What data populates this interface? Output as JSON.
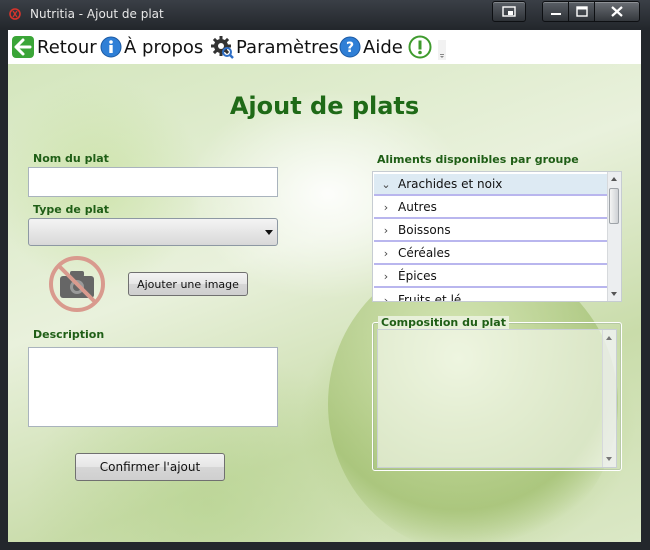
{
  "window": {
    "title": "Nutritia - Ajout de plat"
  },
  "toolbar": {
    "back_label": "Retour",
    "about_label": "À propos",
    "settings_label": "Paramètres",
    "help_label": "Aide"
  },
  "page": {
    "title": "Ajout de plats"
  },
  "form": {
    "name_label": "Nom du plat",
    "name_value": "",
    "type_label": "Type de plat",
    "type_value": "",
    "add_image_label": "Ajouter une image",
    "description_label": "Description",
    "description_value": "",
    "confirm_label": "Confirmer l'ajout"
  },
  "foods": {
    "label": "Aliments disponibles par groupe",
    "groups": [
      {
        "label": "Arachides et noix",
        "expanded": true
      },
      {
        "label": "Autres",
        "expanded": false
      },
      {
        "label": "Boissons",
        "expanded": false
      },
      {
        "label": "Céréales",
        "expanded": false
      },
      {
        "label": "Épices",
        "expanded": false
      },
      {
        "label": "Fruits et lé",
        "expanded": false
      }
    ]
  },
  "composition": {
    "label": "Composition du plat"
  },
  "colors": {
    "heading_green": "#1f6a17",
    "label_green": "#1f5e16",
    "row_border": "#b9b6ee",
    "selected_row": "#ddeaf3"
  },
  "icons": {
    "app": "app-logo-icon",
    "back": "back-arrow-icon",
    "about": "info-icon",
    "settings": "gear-icon",
    "help": "help-icon",
    "alert": "alert-icon",
    "image_placeholder": "no-camera-icon"
  }
}
